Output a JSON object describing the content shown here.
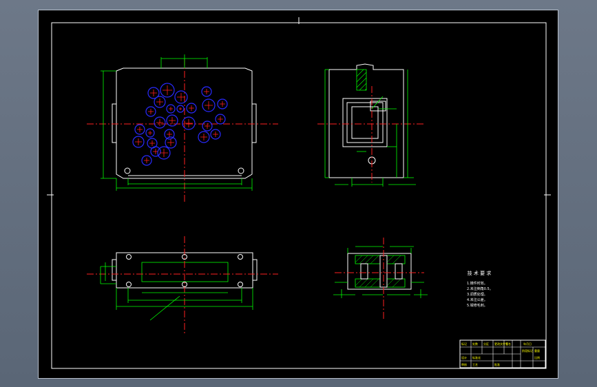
{
  "colors": {
    "background": "#000000",
    "frame": "#ffffff",
    "part_outline": "#ffffff",
    "dimension": "#00ff00",
    "center_line": "#ff2020",
    "hole_circle": "#2a2aff",
    "hatch": "#00ff00",
    "title_block_text": "#ffff00",
    "notes_text": "#ffffff"
  },
  "technical_requirements": {
    "title": "技 术 要 求",
    "items": [
      "1.铸件时效。",
      "2.未注倒角0.5。",
      "3.调质处理。",
      "4.未注公差。",
      "5.钳修毛刺。"
    ]
  },
  "title_block": {
    "row1": [
      "标记",
      "处数",
      "分区",
      "更改文件号",
      "签名",
      "年月日"
    ],
    "row2": [
      "设计",
      "标准化",
      "阶段标记",
      "重量",
      "比例"
    ],
    "row3": [
      "审核",
      "工艺",
      "批准"
    ]
  }
}
